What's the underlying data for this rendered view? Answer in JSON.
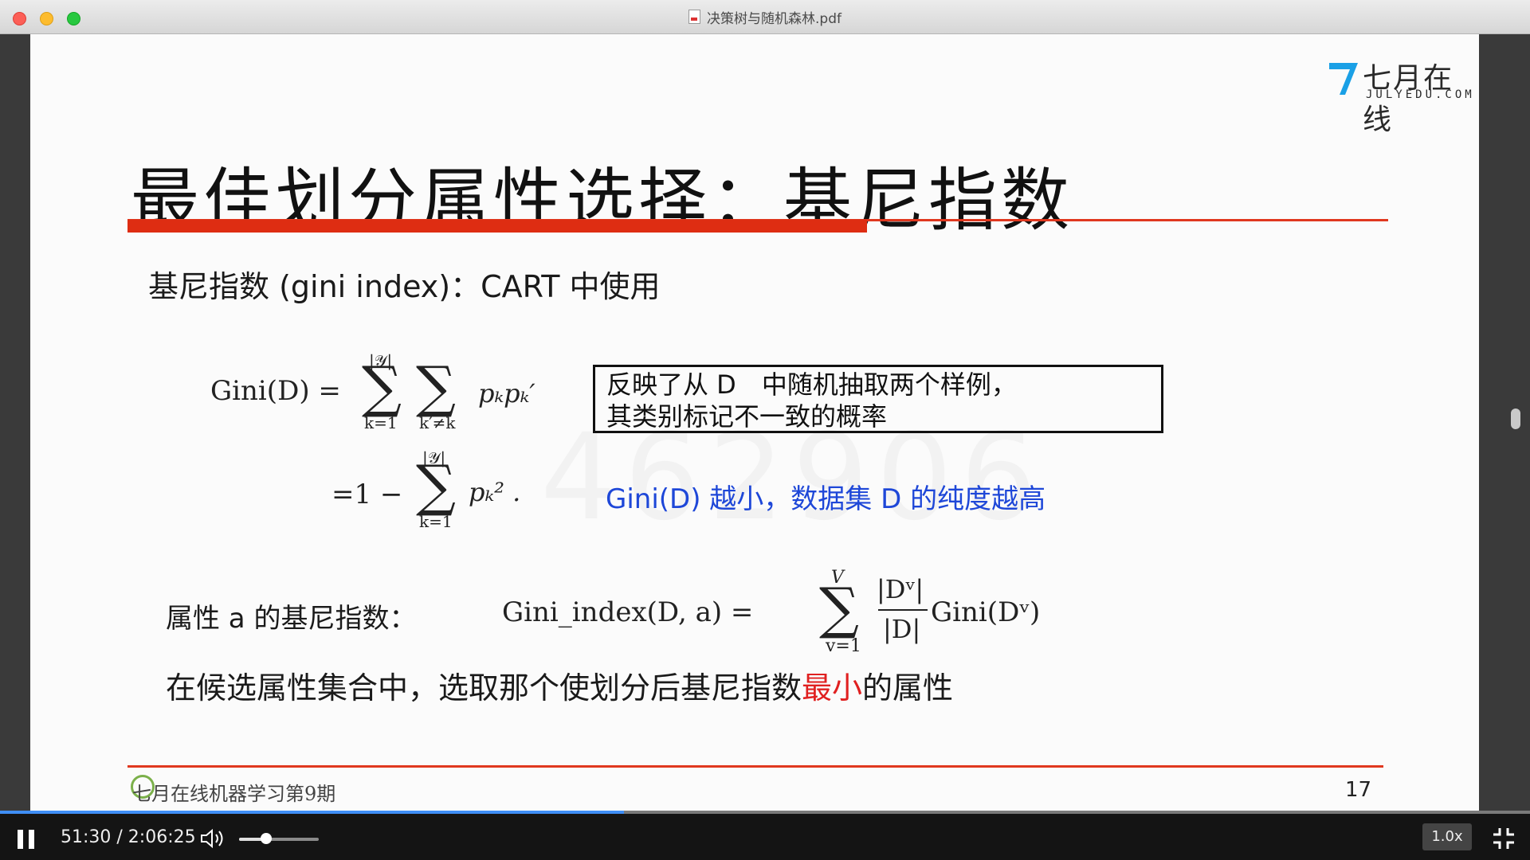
{
  "window": {
    "title": "决策树与随机森林.pdf"
  },
  "brand": {
    "name": "七月在线",
    "url": "JULYEDU.COM",
    "mark": "7",
    "accent": "#1aa0e6"
  },
  "slide": {
    "title": "最佳划分属性选择：基尼指数",
    "subtitle": "基尼指数 (gini index)：CART 中使用",
    "formula": {
      "lhs": "Gini(D) =",
      "sum_symbol": "∑",
      "sum1_upper": "|𝒴|",
      "sum1_lower": "k=1",
      "sum2_lower": "k′≠k",
      "term1": "pₖpₖ′",
      "line2_prefix": "=1 −",
      "sum3_upper": "|𝒴|",
      "sum3_lower": "k=1",
      "term2": "pₖ² ."
    },
    "note_line1": "反映了从 D　中随机抽取两个样例，",
    "note_line2": "其类别标记不一致的概率",
    "blue_note": "Gini(D) 越小，数据集 D 的纯度越高",
    "watermark": "462906",
    "attr_label": "属性 a 的基尼指数：",
    "attr_formula": {
      "lhs": "Gini_index(D, a) =",
      "sum_upper": "V",
      "sum_lower": "v=1",
      "frac_top": "|Dᵛ|",
      "frac_bottom": "|D|",
      "rhs": "Gini(Dᵛ)"
    },
    "conclusion_pre": "在候选属性集合中，选取那个使划分后基尼指数",
    "conclusion_highlight": "最小",
    "conclusion_post": "的属性",
    "footer_text": "七月在线机器学习第9期",
    "page_number": "17",
    "rule_color": "#e0381f",
    "highlight_color": "#e02020",
    "blue_color": "#1e47d8"
  },
  "player": {
    "time": "51:30 / 2:06:25",
    "progress": 0.408,
    "volume": 0.34,
    "speed": "1.0x",
    "play_state": "playing",
    "icons": {
      "pause": "pause-icon",
      "volume": "volume-icon",
      "exit_fullscreen": "exit-fullscreen-icon"
    }
  }
}
